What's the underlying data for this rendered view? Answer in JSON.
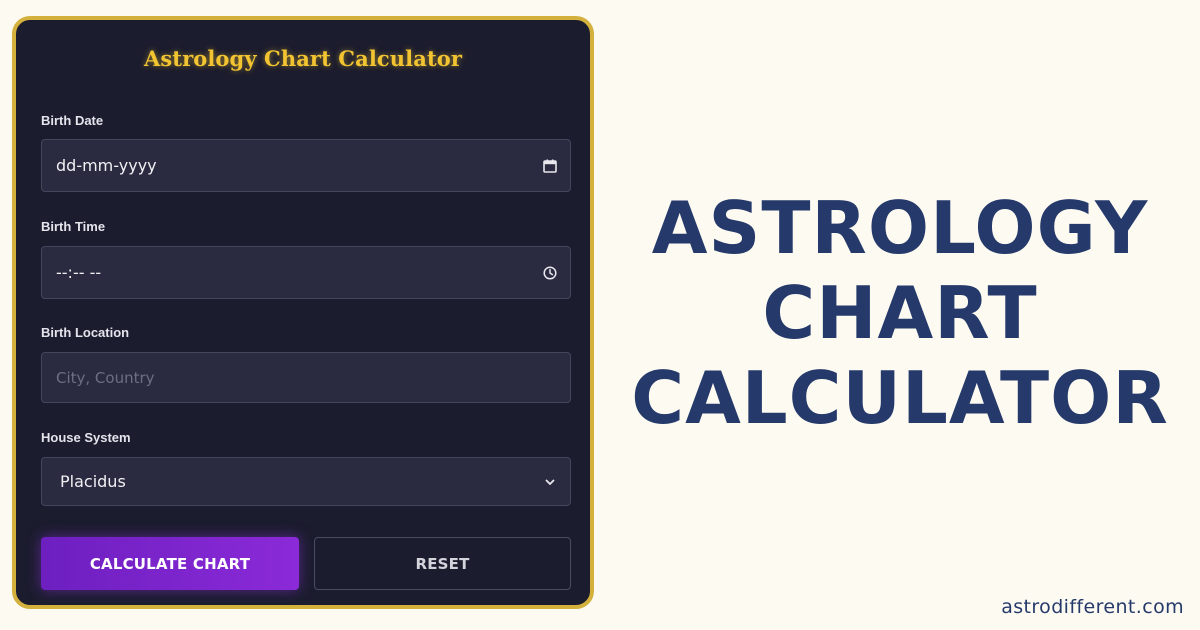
{
  "panel": {
    "title": "Astrology Chart Calculator",
    "fields": {
      "birth_date": {
        "label": "Birth Date",
        "value": "dd-mm-yyyy",
        "icon": "calendar-icon"
      },
      "birth_time": {
        "label": "Birth Time",
        "value": "--:-- --",
        "icon": "clock-icon"
      },
      "birth_location": {
        "label": "Birth Location",
        "placeholder": "City, Country"
      },
      "house_system": {
        "label": "House System",
        "selected": "Placidus",
        "icon": "chevron-down-icon"
      }
    },
    "buttons": {
      "calculate": "CALCULATE CHART",
      "reset": "RESET"
    }
  },
  "headline": {
    "line1": "ASTROLOGY",
    "line2": "CHART",
    "line3": "CALCULATOR"
  },
  "site": "astrodifferent.com",
  "colors": {
    "background": "#fdfaf2",
    "panel": "#1b1c2e",
    "panel_border": "#d3b13c",
    "title_gold": "#f2c431",
    "field_bg": "#2a2b40",
    "accent_purple": "#7b24cc",
    "headline_navy": "#253a6a"
  }
}
